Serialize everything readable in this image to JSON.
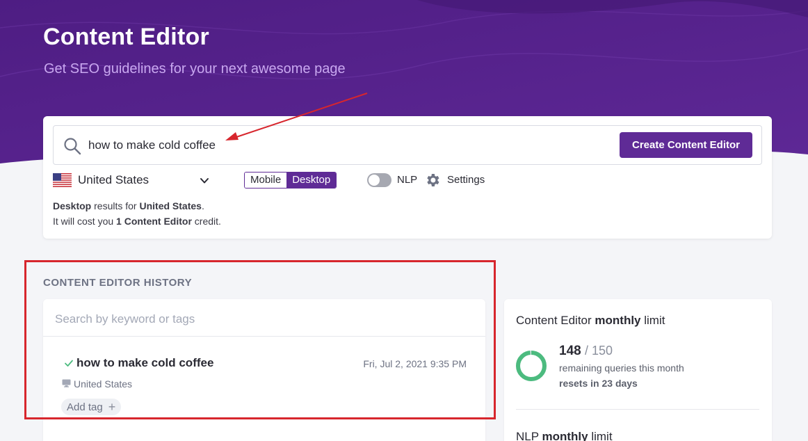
{
  "header": {
    "title": "Content Editor",
    "subtitle": "Get SEO guidelines for your next awesome page"
  },
  "search": {
    "query": "how to make cold coffee",
    "create_button": "Create Content Editor",
    "country": "United States",
    "device_options": [
      "Mobile",
      "Desktop"
    ],
    "selected_device": "Desktop",
    "nlp_label": "NLP",
    "nlp_enabled": false,
    "settings_label": "Settings",
    "info": {
      "device": "Desktop",
      "results_for_text": " results for ",
      "country": "United States",
      "period": ".",
      "cost_prefix": "It will cost you ",
      "cost_amount": "1 Content Editor",
      "cost_suffix": " credit."
    }
  },
  "history": {
    "title": "CONTENT EDITOR HISTORY",
    "search_placeholder": "Search by keyword or tags",
    "entries": [
      {
        "keyword": "how to make cold coffee",
        "date": "Fri, Jul 2, 2021 9:35 PM",
        "country": "United States",
        "add_tag_label": "Add tag"
      }
    ]
  },
  "limits": {
    "content_editor": {
      "title_prefix": "Content Editor ",
      "title_bold": "monthly",
      "title_suffix": " limit",
      "remaining": "148",
      "total": "/ 150",
      "remaining_label": "remaining queries this month",
      "reset_label": "resets in 23 days",
      "ring_fraction": 0.987
    },
    "nlp": {
      "title_prefix": "NLP ",
      "title_bold": "monthly",
      "title_suffix": " limit"
    }
  },
  "colors": {
    "brand_purple": "#5f2b96",
    "hero_purple": "#5a2590",
    "ring_green": "#4cbb7f",
    "annotation_red": "#d7262d"
  }
}
